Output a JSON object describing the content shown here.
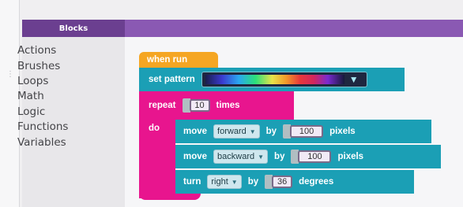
{
  "toolbox": {
    "header": "Blocks",
    "categories": [
      "Actions",
      "Brushes",
      "Loops",
      "Math",
      "Logic",
      "Functions",
      "Variables"
    ]
  },
  "program": {
    "when_run": "when run",
    "set_pattern": {
      "label": "set pattern"
    },
    "repeat": {
      "label": "repeat",
      "count": "10",
      "suffix": "times",
      "do_label": "do"
    },
    "move1": {
      "label": "move",
      "direction": "forward",
      "by": "by",
      "amount": "100",
      "unit": "pixels"
    },
    "move2": {
      "label": "move",
      "direction": "backward",
      "by": "by",
      "amount": "100",
      "unit": "pixels"
    },
    "turn": {
      "label": "turn",
      "direction": "right",
      "by": "by",
      "amount": "36",
      "unit": "degrees"
    }
  },
  "colors": {
    "header": "#6b3f90",
    "event_block": "#f5a623",
    "action_block": "#1b9fb5",
    "loop_block": "#e8158e"
  }
}
